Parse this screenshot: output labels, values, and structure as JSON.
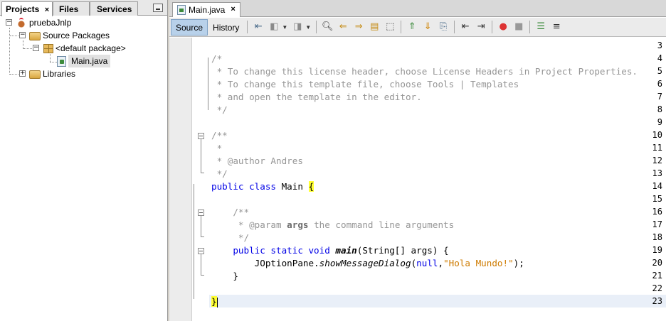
{
  "left_panel": {
    "tabs": [
      {
        "label": "Projects",
        "active": true,
        "closable": true
      },
      {
        "label": "Files",
        "active": false,
        "closable": false
      },
      {
        "label": "Services",
        "active": false,
        "closable": false
      }
    ],
    "close_glyph": "×",
    "tree": {
      "project": "pruebaJnlp",
      "source_packages": "Source Packages",
      "default_package": "<default package>",
      "file": "Main.java",
      "libraries": "Libraries"
    }
  },
  "editor": {
    "tab_label": "Main.java",
    "close_glyph": "×",
    "toolbar": {
      "source_label": "Source",
      "history_label": "History"
    },
    "lines": [
      {
        "n": "3"
      },
      {
        "n": "4"
      },
      {
        "n": "5"
      },
      {
        "n": "6"
      },
      {
        "n": "7"
      },
      {
        "n": "8"
      },
      {
        "n": "9"
      },
      {
        "n": "10"
      },
      {
        "n": "11"
      },
      {
        "n": "12"
      },
      {
        "n": "13"
      },
      {
        "n": "14"
      },
      {
        "n": "15"
      },
      {
        "n": "16"
      },
      {
        "n": "17"
      },
      {
        "n": "18"
      },
      {
        "n": "19"
      },
      {
        "n": "20"
      },
      {
        "n": "21"
      },
      {
        "n": "22"
      },
      {
        "n": "23"
      }
    ],
    "code": {
      "l4": "/*",
      "l5": " * To change this license header, choose License Headers in Project Properties.",
      "l6": " * To change this template file, choose Tools | Templates",
      "l7": " * and open the template in the editor.",
      "l8": " */",
      "l10": "/**",
      "l11": " *",
      "l12": " * @author Andres",
      "l13": " */",
      "l14_kw": "public class",
      "l14_name": " Main ",
      "l14_brace": "{",
      "l16": "    /**",
      "l17_pre": "     * @param ",
      "l17_arg": "args",
      "l17_post": " the command line arguments",
      "l18": "     */",
      "l19_kw": "    public static void ",
      "l19_method": "main",
      "l19_rest": "(String[] args) {",
      "l20_pre": "        JOptionPane.",
      "l20_method": "showMessageDialog",
      "l20_open": "(",
      "l20_null": "null",
      "l20_comma": ",",
      "l20_str": "\"Hola Mundo!\"",
      "l20_close": ");",
      "l21": "    }",
      "l23_brace": "}"
    }
  },
  "icons": [
    "project-icon",
    "folder-icon",
    "package-icon",
    "java-file-icon",
    "minimize-icon",
    "close-icon"
  ]
}
